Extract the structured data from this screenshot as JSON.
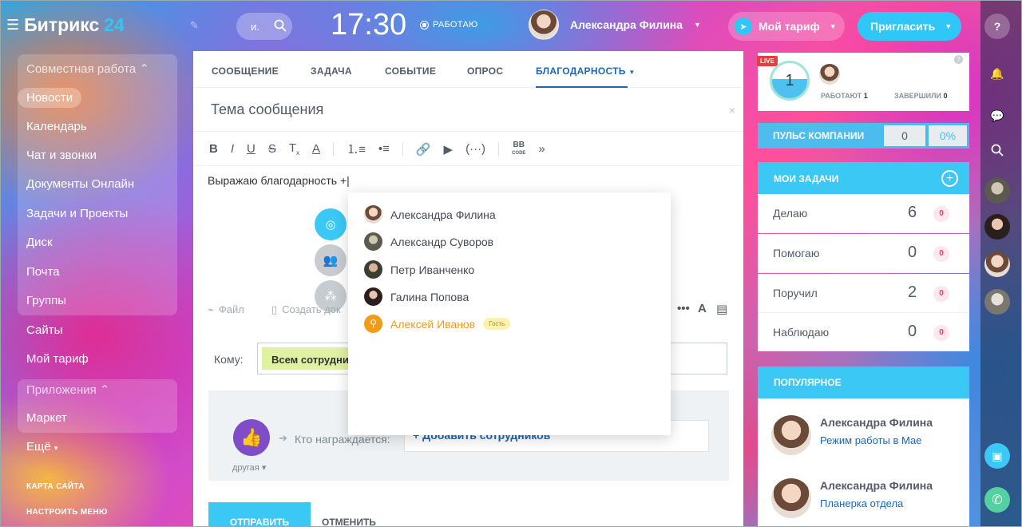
{
  "header": {
    "logo_main": "Битрикс",
    "logo_num": "24",
    "search_placeholder": "и.",
    "clock": "17:30",
    "work_status": "РАБОТАЮ",
    "user_name": "Александра Филина",
    "tariff": "Мой тариф",
    "invite": "Пригласить"
  },
  "menu": {
    "group1_title": "Совместная работа",
    "items": [
      "Новости",
      "Календарь",
      "Чат и звонки",
      "Документы Онлайн",
      "Задачи и Проекты",
      "Диск",
      "Почта",
      "Группы",
      "Сайты",
      "Мой тариф"
    ],
    "group2_title": "Приложения",
    "market": "Маркет",
    "more": "Ещё",
    "sitemap": "КАРТА САЙТА",
    "configure": "НАСТРОИТЬ МЕНЮ"
  },
  "composer": {
    "tabs": [
      "СООБЩЕНИЕ",
      "ЗАДАЧА",
      "СОБЫТИЕ",
      "ОПРОС",
      "БЛАГОДАРНОСТЬ"
    ],
    "subject_placeholder": "Тема сообщения",
    "body_text": "Выражаю благодарность +|",
    "attach_file": "Файл",
    "create_doc": "Создать док",
    "to_label": "Кому:",
    "to_chip": "Всем сотрудникам",
    "badge_caption": "другая",
    "awarded_label": "Кто награждается:",
    "add_employees": "+ Добавить сотрудников",
    "send": "ОТПРАВИТЬ",
    "cancel": "ОТМЕНИТЬ"
  },
  "mention_popup": {
    "people": [
      "Александра Филина",
      "Александр Суворов",
      "Петр Иванченко",
      "Галина Попова"
    ],
    "guest_name": "Алексей Иванов",
    "guest_badge": "Гость"
  },
  "stream": {
    "live": "LIVE",
    "working_count": "1",
    "working_label": "РАБОТАЮТ",
    "working_num": "1",
    "finished_label": "ЗАВЕРШИЛИ",
    "finished_num": "0"
  },
  "pulse": {
    "label": "ПУЛЬС КОМПАНИИ",
    "value": "0",
    "percent": "0%"
  },
  "my_tasks": {
    "title": "МОИ ЗАДАЧИ",
    "rows": [
      {
        "label": "Делаю",
        "count": "6",
        "overdue": "0"
      },
      {
        "label": "Помогаю",
        "count": "0",
        "overdue": "0"
      },
      {
        "label": "Поручил",
        "count": "2",
        "overdue": "0"
      },
      {
        "label": "Наблюдаю",
        "count": "0",
        "overdue": "0"
      }
    ]
  },
  "popular": {
    "title": "ПОПУЛЯРНОЕ",
    "posts": [
      {
        "author": "Александра Филина",
        "topic": "Режим работы в Мае"
      },
      {
        "author": "Александра Филина",
        "topic": "Планерка отдела"
      }
    ]
  },
  "colors": {
    "accent": "#3bc8f5",
    "link": "#2067b0",
    "guest": "#f29b16",
    "badge_purple": "#7f4dc7"
  }
}
